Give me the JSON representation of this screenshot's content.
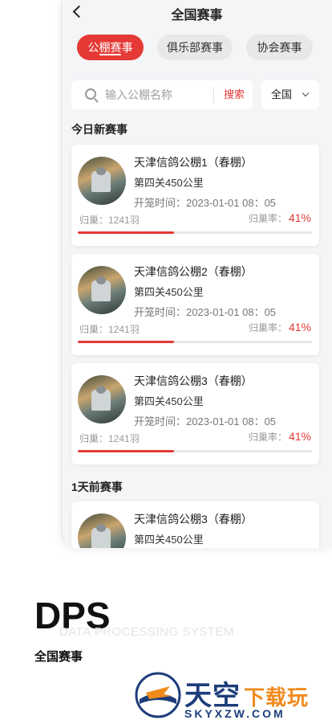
{
  "header": {
    "title": "全国赛事"
  },
  "tabs": [
    {
      "label": "公棚赛事",
      "active": true
    },
    {
      "label": "俱乐部赛事",
      "active": false
    },
    {
      "label": "协会赛事",
      "active": false
    }
  ],
  "search": {
    "placeholder": "输入公棚名称",
    "button_label": "搜索",
    "filter_value": "全国"
  },
  "sections": {
    "today": "今日新赛事",
    "yesterday": "1天前赛事"
  },
  "cards": [
    {
      "name": "天津信鸽公棚1（春棚）",
      "distance": "第四关450公里",
      "start_time": "开笼时间：2023-01-01 08：05",
      "returned": "归巢：1241羽",
      "rate_label": "归巢率：",
      "rate": "41%",
      "progress": 0.41
    },
    {
      "name": "天津信鸽公棚2（春棚）",
      "distance": "第四关450公里",
      "start_time": "开笼时间：2023-01-01 08：05",
      "returned": "归巢：1241羽",
      "rate_label": "归巢率：",
      "rate": "41%",
      "progress": 0.41
    },
    {
      "name": "天津信鸽公棚3（春棚）",
      "distance": "第四关450公里",
      "start_time": "开笼时间：2023-01-01 08：05",
      "returned": "归巢：1241羽",
      "rate_label": "归巢率：",
      "rate": "41%",
      "progress": 0.41
    },
    {
      "name": "天津信鸽公棚3（春棚）",
      "distance": "第四关450公里"
    }
  ],
  "promo": {
    "logo_text": "DPS",
    "logo_subtitle": "DATA PROCESSING SYSTEM",
    "caption": "全国赛事"
  },
  "brand": {
    "name_main": "天空",
    "name_accent": "下载玩",
    "url": "SKYXZW.COM"
  },
  "colors": {
    "accent": "#e53935",
    "brand_blue": "#1d3d7a",
    "brand_orange": "#f08a1c"
  }
}
